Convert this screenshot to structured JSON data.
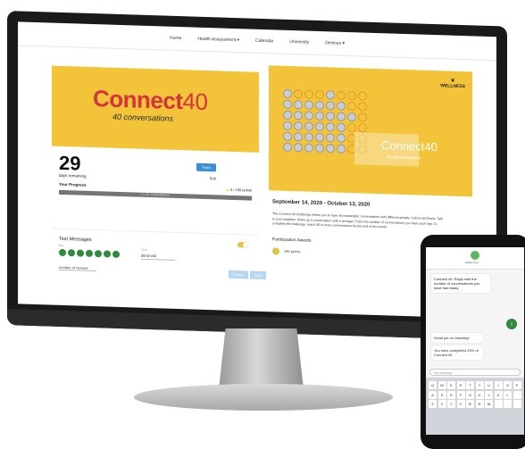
{
  "nav": {
    "items": [
      "Home",
      "Health Assessment ▾",
      "Calendar",
      "University",
      "Devices ▾"
    ]
  },
  "banner": {
    "brand_main": "Connect",
    "brand_num": "40",
    "subtitle": "40 conversations"
  },
  "stats": {
    "days": "29",
    "days_label": "days remaining",
    "progress_label": "Your Progress",
    "progress_fraction": 0.0,
    "progress_text": "0 / 40 conversations",
    "track_button": "Track",
    "sub_label": "Sub",
    "points": "0 / 150 points"
  },
  "text_messages": {
    "title": "Text Messages",
    "day_label": "Day",
    "time_label": "Time",
    "time_value": "09:00 AM",
    "reviews_label": "number of reviews",
    "cancel_button": "Cancel",
    "save_button": "Save"
  },
  "challenge": {
    "logo_text": "WELLNESS",
    "hero_title": "Connect40",
    "hero_subtitle": "40 conversations",
    "dates": "September 14, 2020 - October 13, 2020",
    "description": "The Connect 40 Challenge invites you to have 40 meaningful conversations with different people. Call an old friend. Talk to your neighbor. Strike up a conversation with a stranger. Track the number of conversations you have each day. To complete the challenge, reach 40 or more conversations by the end of the month.",
    "awards_title": "Participation Awards",
    "award_value": "150 points"
  },
  "phone": {
    "contact": "Wellsource",
    "msg1": "Connect 40: Reply with the number of conversations you have had today",
    "msg2": "2",
    "msg3": "Great job on reaching!",
    "msg4": "You have completed 20% of Connect 40",
    "input_placeholder": "Text message",
    "keys": [
      "Q",
      "W",
      "E",
      "R",
      "T",
      "Y",
      "U",
      "I",
      "O",
      "P",
      "A",
      "S",
      "D",
      "F",
      "G",
      "H",
      "J",
      "K",
      "L",
      "",
      "Z",
      "X",
      "C",
      "V",
      "B",
      "N",
      "M",
      "",
      "",
      ""
    ]
  },
  "colors": {
    "banner_yellow": "#f3c43a",
    "brand_red": "#d6343c",
    "primary_blue": "#3a8fd6",
    "dot_green": "#2e8b3e"
  }
}
